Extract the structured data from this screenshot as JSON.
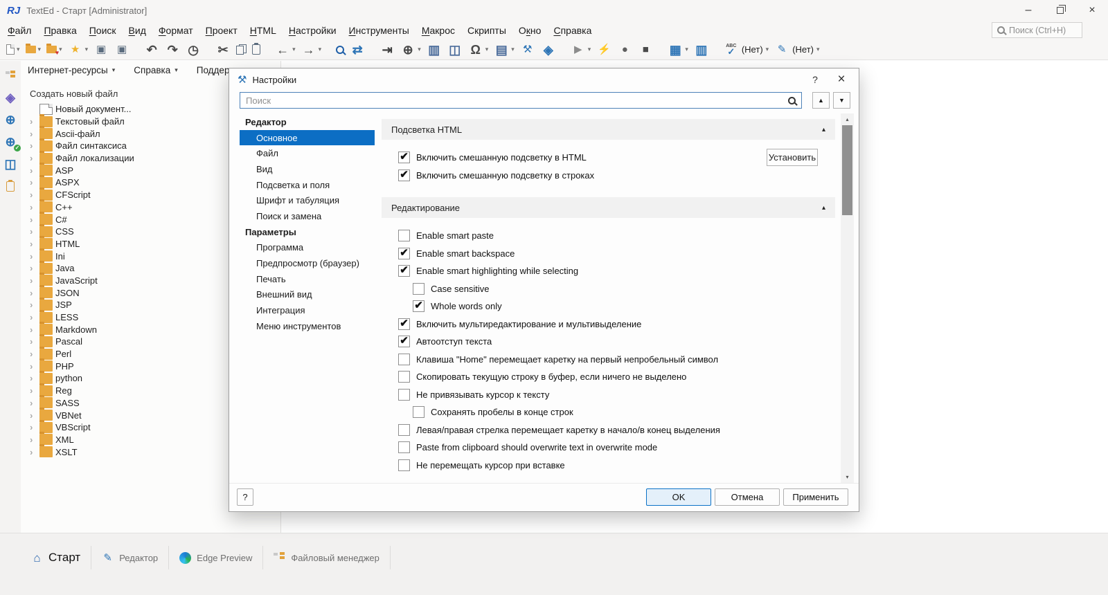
{
  "titlebar": {
    "app_title": "TextEd - Старт [Administrator]",
    "logo_text": "RJ",
    "controls": [
      {
        "name": "minimize-button",
        "glyph": "–"
      },
      {
        "name": "maximize-button",
        "icon": "icrestore"
      },
      {
        "name": "close-button",
        "glyph": "×"
      }
    ]
  },
  "menubar": {
    "items": [
      {
        "label": "Файл",
        "u": 0
      },
      {
        "label": "Правка",
        "u": 0
      },
      {
        "label": "Поиск",
        "u": 0
      },
      {
        "label": "Вид",
        "u": 0
      },
      {
        "label": "Формат",
        "u": 0
      },
      {
        "label": "Проект",
        "u": 0
      },
      {
        "label": "HTML",
        "u": 0
      },
      {
        "label": "Настройки",
        "u": 0
      },
      {
        "label": "Инструменты",
        "u": 0
      },
      {
        "label": "Макрос",
        "u": 0
      },
      {
        "label": "Скрипты",
        "u": -1
      },
      {
        "label": "Окно",
        "u": 1
      },
      {
        "label": "Справка",
        "u": 0
      }
    ],
    "search_placeholder": "Поиск (Ctrl+H)"
  },
  "toolbar": {
    "items": [
      {
        "name": "new-document-button",
        "icon": "icpage",
        "dd": true
      },
      {
        "name": "open-file-button",
        "icon": "icf",
        "dd": true
      },
      {
        "name": "open-favorite-button",
        "icon": "icf fav",
        "dd": true
      },
      {
        "name": "favorites-button",
        "glyph": "★",
        "color": "#eeb22c",
        "dd": true
      },
      {
        "name": "save-button",
        "glyph": "▣",
        "color": "#5a6b7d"
      },
      {
        "name": "save-all-button",
        "glyph": "▣",
        "color": "#5a6b7d"
      },
      {
        "name": "undo-button",
        "glyph": "↶",
        "color": "#4a4a4a",
        "cls": "gap big"
      },
      {
        "name": "redo-button",
        "glyph": "↷",
        "color": "#4a4a4a",
        "cls": "big"
      },
      {
        "name": "history-button",
        "glyph": "◷",
        "color": "#4a4a4a",
        "cls": "big"
      },
      {
        "name": "cut-button",
        "glyph": "✂",
        "color": "#4a4a4a",
        "cls": "gap big"
      },
      {
        "name": "copy-button",
        "icon": "iccopy",
        "color": "#5a6b7d"
      },
      {
        "name": "paste-button",
        "icon": "icpaste",
        "color": "#5a6b7d"
      },
      {
        "name": "back-button",
        "glyph": "←",
        "color": "#3f3f3f",
        "cls": "gap big",
        "dd": true
      },
      {
        "name": "forward-button",
        "glyph": "→",
        "color": "#3f3f3f",
        "cls": "big",
        "dd": true
      },
      {
        "name": "find-button",
        "icon": "icsearch",
        "color": "#1f5fa8",
        "cls": "gap"
      },
      {
        "name": "compare-button",
        "glyph": "⇄",
        "color": "#2e75b6",
        "cls": "big"
      },
      {
        "name": "goto-editor-button",
        "glyph": "⇥",
        "color": "#3f3f3f",
        "cls": "gap big"
      },
      {
        "name": "browser-button",
        "glyph": "⊕",
        "color": "#4a4a4a",
        "cls": "big",
        "dd": true
      },
      {
        "name": "code-preview-button",
        "glyph": "▥",
        "color": "#4a6b9a",
        "cls": "big"
      },
      {
        "name": "browser-preview-button",
        "glyph": "◫",
        "color": "#4a6b9a",
        "cls": "big"
      },
      {
        "name": "special-chars-button",
        "glyph": "Ω",
        "color": "#4a4a4a",
        "cls": "big",
        "dd": true
      },
      {
        "name": "print-button",
        "glyph": "▤",
        "color": "#4a6b9a",
        "cls": "big",
        "dd": true
      },
      {
        "name": "tools-button",
        "glyph": "⚒",
        "color": "#2e75b6"
      },
      {
        "name": "plugins-button",
        "glyph": "◈",
        "color": "#2e75b6",
        "cls": "big"
      },
      {
        "name": "run-button",
        "glyph": "▶",
        "color": "#8c8c8c",
        "cls": "gap",
        "dd": true
      },
      {
        "name": "quick-run-button",
        "glyph": "⚡",
        "color": "#9c9c9c"
      },
      {
        "name": "record-macro-button",
        "glyph": "●",
        "color": "#5f5f5f"
      },
      {
        "name": "stop-button",
        "glyph": "■",
        "color": "#4a4a4a"
      },
      {
        "name": "layout-button",
        "glyph": "▦",
        "color": "#2e75b6",
        "cls": "gap big",
        "dd": true
      },
      {
        "name": "columns-button",
        "glyph": "▥",
        "color": "#2e75b6",
        "cls": "big"
      },
      {
        "name": "spellcheck-button",
        "icon": "icabc",
        "label": "(Нет)",
        "cls": "gap",
        "dd": true
      },
      {
        "name": "highlighter-button",
        "glyph": "✎",
        "color": "#2e75b6",
        "label": "(Нет)",
        "dd": true
      }
    ]
  },
  "rail": {
    "items": [
      {
        "name": "file-manager-icon",
        "icon": "ictree"
      },
      {
        "name": "snippets-icon",
        "glyph": "◈",
        "color": "#7060c0"
      },
      {
        "name": "web-browser-icon",
        "glyph": "⊕",
        "color": "#2e75b6"
      },
      {
        "name": "web-validate-icon",
        "glyph": "⊕",
        "color": "#2e75b6",
        "ic_cls": "badge-check"
      },
      {
        "name": "form-preview-icon",
        "glyph": "◫",
        "color": "#2e75b6"
      },
      {
        "name": "clipboard-icon",
        "icon": "icpaste",
        "color": "#d89c3e"
      }
    ]
  },
  "sidebar": {
    "links": [
      {
        "name": "link-internet-resources",
        "label": "Интернет-ресурсы",
        "dd": true
      },
      {
        "name": "link-help",
        "label": "Справка",
        "dd": true
      },
      {
        "name": "link-support",
        "label": "Поддержка"
      }
    ],
    "section_title": "Создать новый файл",
    "items": [
      {
        "label": "Новый документ...",
        "icon": "icpage",
        "chev": false
      },
      {
        "label": "Текстовый файл",
        "icon": "icf"
      },
      {
        "label": "Ascii-файл",
        "icon": "icf"
      },
      {
        "label": "Файл синтаксиса",
        "icon": "icf"
      },
      {
        "label": "Файл локализации",
        "icon": "icf"
      },
      {
        "label": "ASP",
        "icon": "icf"
      },
      {
        "label": "ASPX",
        "icon": "icf"
      },
      {
        "label": "CFScript",
        "icon": "icf"
      },
      {
        "label": "C++",
        "icon": "icf"
      },
      {
        "label": "C#",
        "icon": "icf"
      },
      {
        "label": "CSS",
        "icon": "icf"
      },
      {
        "label": "HTML",
        "icon": "icf"
      },
      {
        "label": "Ini",
        "icon": "icf"
      },
      {
        "label": "Java",
        "icon": "icf"
      },
      {
        "label": "JavaScript",
        "icon": "icf"
      },
      {
        "label": "JSON",
        "icon": "icf"
      },
      {
        "label": "JSP",
        "icon": "icf"
      },
      {
        "label": "LESS",
        "icon": "icf"
      },
      {
        "label": "Markdown",
        "icon": "icf"
      },
      {
        "label": "Pascal",
        "icon": "icf"
      },
      {
        "label": "Perl",
        "icon": "icf"
      },
      {
        "label": "PHP",
        "icon": "icf"
      },
      {
        "label": "python",
        "icon": "icf"
      },
      {
        "label": "Reg",
        "icon": "icf"
      },
      {
        "label": "SASS",
        "icon": "icf"
      },
      {
        "label": "VBNet",
        "icon": "icf"
      },
      {
        "label": "VBScript",
        "icon": "icf"
      },
      {
        "label": "XML",
        "icon": "icf"
      },
      {
        "label": "XSLT",
        "icon": "icf"
      }
    ]
  },
  "dialog": {
    "title": "Настройки",
    "help": "?",
    "close": "×",
    "search_placeholder": "Поиск",
    "search_up": "▲",
    "search_down": "▼",
    "nav": [
      {
        "label": "Редактор",
        "header": true
      },
      {
        "label": "Основное",
        "selected": true
      },
      {
        "label": "Файл"
      },
      {
        "label": "Вид"
      },
      {
        "label": "Подсветка и поля"
      },
      {
        "label": "Шрифт и табуляция"
      },
      {
        "label": "Поиск и замена"
      },
      {
        "label": "Параметры",
        "header": true
      },
      {
        "label": "Программа"
      },
      {
        "label": "Предпросмотр (браузер)"
      },
      {
        "label": "Печать"
      },
      {
        "label": "Внешний вид"
      },
      {
        "label": "Интеграция"
      },
      {
        "label": "Меню инструментов"
      }
    ],
    "section1_title": "Подсветка HTML",
    "section2_title": "Редактирование",
    "install_label": "Установить",
    "html_checks": [
      {
        "label": "Включить смешанную подсветку в HTML",
        "checked": true
      },
      {
        "label": "Включить смешанную подсветку в строках",
        "checked": true
      }
    ],
    "edit_checks": [
      {
        "label": "Enable smart paste",
        "checked": false
      },
      {
        "label": "Enable smart backspace",
        "checked": true
      },
      {
        "label": "Enable smart highlighting while selecting",
        "checked": true
      },
      {
        "label": "Case sensitive",
        "checked": false,
        "indent": 1
      },
      {
        "label": "Whole words only",
        "checked": true,
        "indent": 1
      },
      {
        "label": "Включить мультиредактирование и мультивыделение",
        "checked": true
      },
      {
        "label": "Автоотступ текста",
        "checked": true
      },
      {
        "label": "Клавиша \"Home\" перемещает каретку на первый непробельный символ",
        "checked": false
      },
      {
        "label": "Скопировать текущую строку в буфер, если ничего не выделено",
        "checked": false
      },
      {
        "label": "Не привязывать курсор к тексту",
        "checked": false
      },
      {
        "label": "Сохранять пробелы в конце строк",
        "checked": false,
        "indent": 1
      },
      {
        "label": "Левая/правая стрелка перемещает каретку в начало/в конец выделения",
        "checked": false
      },
      {
        "label": "Paste from clipboard should overwrite text in overwrite mode",
        "checked": false
      },
      {
        "label": "Не перемещать курсор при вставке",
        "checked": false
      }
    ],
    "footer": {
      "help": "?",
      "ok": "OK",
      "cancel": "Отмена",
      "apply": "Применить"
    }
  },
  "tabbar": {
    "tabs": [
      {
        "name": "tab-start",
        "label": "Старт",
        "glyph": "⌂",
        "active": true
      },
      {
        "name": "tab-editor",
        "label": "Редактор",
        "glyph": "✎"
      },
      {
        "name": "tab-edge-preview",
        "label": "Edge Preview",
        "icon": "icedge"
      },
      {
        "name": "tab-file-manager",
        "label": "Файловый менеджер",
        "icon": "ictree"
      }
    ]
  }
}
